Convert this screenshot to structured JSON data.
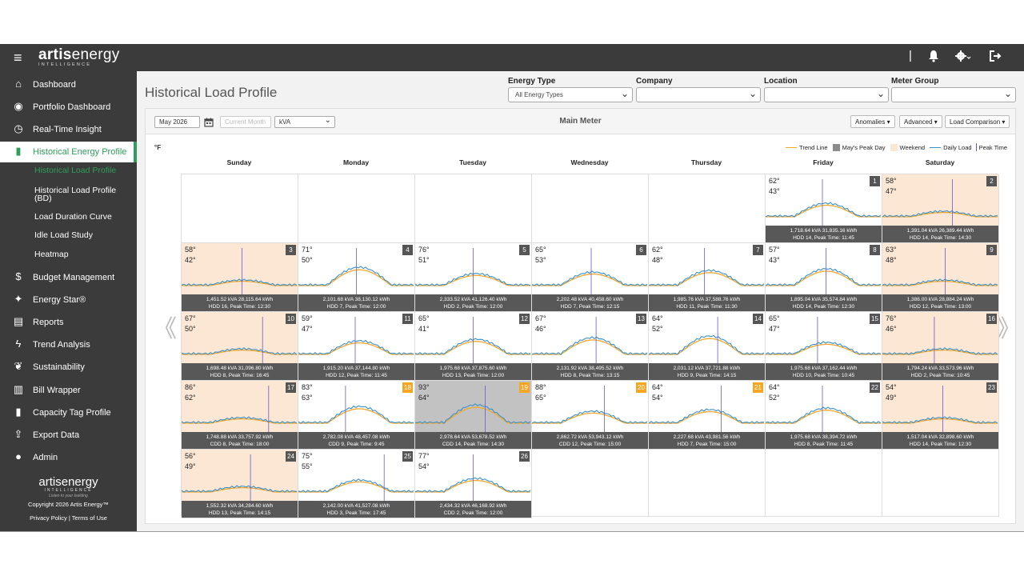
{
  "app": {
    "logo_main": "artisenergy",
    "logo_bold": "artis",
    "logo_rest": "energy",
    "logo_sub": "INTELLIGENCE",
    "hamburger_icon": "≡",
    "icons": {
      "bell": "bell-icon",
      "gear": "gear-icon",
      "logout": "logout-icon"
    }
  },
  "sidebar": {
    "items": [
      {
        "label": "Dashboard",
        "icon": "home-icon",
        "glyph": "⌂"
      },
      {
        "label": "Portfolio Dashboard",
        "icon": "speedometer-icon",
        "glyph": "◉"
      },
      {
        "label": "Real-Time Insight",
        "icon": "clock-icon",
        "glyph": "◷"
      },
      {
        "label": "Historical Energy Profile",
        "icon": "bar-chart-icon",
        "glyph": "▮"
      },
      {
        "label": "Budget Management",
        "icon": "dollar-icon",
        "glyph": "$"
      },
      {
        "label": "Energy Star®",
        "icon": "energy-star-icon",
        "glyph": "✦"
      },
      {
        "label": "Reports",
        "icon": "report-icon",
        "glyph": "▤"
      },
      {
        "label": "Trend Analysis",
        "icon": "lightning-icon",
        "glyph": "ϟ"
      },
      {
        "label": "Sustainability",
        "icon": "leaf-icon",
        "glyph": "❦"
      },
      {
        "label": "Bill Wrapper",
        "icon": "bill-icon",
        "glyph": "▥"
      },
      {
        "label": "Capacity Tag Profile",
        "icon": "capacity-icon",
        "glyph": "▮"
      },
      {
        "label": "Export Data",
        "icon": "export-icon",
        "glyph": "⇪"
      },
      {
        "label": "Admin",
        "icon": "user-icon",
        "glyph": "●"
      }
    ],
    "subitems": [
      "Historical Load Profile",
      "Historical Load Profile (BD)",
      "Load Duration Curve",
      "Idle Load Study",
      "Heatmap"
    ],
    "footer_logo": "artisenergy",
    "footer_logo_sub": "INTELLIGENCE",
    "footer_tagline": "Listen to your building",
    "copyright": "Copyright 2026 Artis Energy™",
    "privacy": "Privacy Policy",
    "terms": "Terms of Use"
  },
  "header": {
    "title": "Historical Load Profile",
    "filters": [
      {
        "label": "Energy Type",
        "value": "All Energy Types"
      },
      {
        "label": "Company",
        "value": ""
      },
      {
        "label": "Location",
        "value": ""
      },
      {
        "label": "Meter Group",
        "value": ""
      }
    ]
  },
  "toolbar": {
    "month": "May 2026",
    "current_month": "Current Month",
    "unit": "kVA",
    "meter": "Main Meter",
    "anomalies": "Anomalies ▾",
    "advanced": "Advanced ▾",
    "load_comparison": "Load Comparison ▾"
  },
  "calendar": {
    "temp_unit": "°F",
    "legend": {
      "trend_line": "Trend Line",
      "peak_day": "May's Peak Day",
      "weekend": "Weekend",
      "daily_load": "Daily Load",
      "peak_time": "Peak Time",
      "colors": {
        "trend": "#f0a830",
        "peak": "#8c8c8c",
        "weekend": "#fbe7d3",
        "daily": "#3a8fc8",
        "peak_time": "#6a5acd"
      }
    },
    "weekdays": [
      "Sunday",
      "Monday",
      "Tuesday",
      "Wednesday",
      "Thursday",
      "Friday",
      "Saturday"
    ],
    "days": [
      {
        "day": "1",
        "hi": "62°",
        "lo": "43°",
        "f1": "1,718.64 kVA 31,835.16 kWh",
        "f2": "HDD 14, Peak Time: 11:45"
      },
      {
        "day": "2",
        "hi": "58°",
        "lo": "47°",
        "f1": "1,391.04 kVA 26,389.44 kWh",
        "f2": "HDD 14, Peak Time: 14:30"
      },
      {
        "day": "3",
        "hi": "58°",
        "lo": "42°",
        "f1": "1,451.52 kVA 28,115.64 kWh",
        "f2": "HDD 16, Peak Time: 12:30"
      },
      {
        "day": "4",
        "hi": "71°",
        "lo": "50°",
        "f1": "2,101.68 kVA 38,130.12 kWh",
        "f2": "HDD 7, Peak Time: 12:00"
      },
      {
        "day": "5",
        "hi": "76°",
        "lo": "51°",
        "f1": "2,333.52 kVA 41,126.40 kWh",
        "f2": "HDD 2, Peak Time: 12:00"
      },
      {
        "day": "6",
        "hi": "65°",
        "lo": "53°",
        "f1": "2,202.48 kVA 40,458.60 kWh",
        "f2": "HDD 7, Peak Time: 12:15"
      },
      {
        "day": "7",
        "hi": "62°",
        "lo": "48°",
        "f1": "1,985.76 kVA 37,588.76 kWh",
        "f2": "HDD 11, Peak Time: 11:30"
      },
      {
        "day": "8",
        "hi": "57°",
        "lo": "43°",
        "f1": "1,895.04 kVA 35,574.84 kWh",
        "f2": "HDD 14, Peak Time: 12:30"
      },
      {
        "day": "9",
        "hi": "63°",
        "lo": "48°",
        "f1": "1,386.00 kVA 28,884.24 kWh",
        "f2": "HDD 12, Peak Time: 13:00"
      },
      {
        "day": "10",
        "hi": "67°",
        "lo": "50°",
        "f1": "1,698.48 kVA 31,096.80 kWh",
        "f2": "HDD 8, Peak Time: 16:45"
      },
      {
        "day": "11",
        "hi": "59°",
        "lo": "47°",
        "f1": "1,915.20 kVA 37,144.80 kWh",
        "f2": "HDD 12, Peak Time: 11:45"
      },
      {
        "day": "12",
        "hi": "65°",
        "lo": "41°",
        "f1": "1,975.68 kVA 37,875.60 kWh",
        "f2": "HDD 13, Peak Time: 12:00"
      },
      {
        "day": "13",
        "hi": "67°",
        "lo": "46°",
        "f1": "2,131.92 kVA 38,495.52 kWh",
        "f2": "HDD 8, Peak Time: 13:15"
      },
      {
        "day": "14",
        "hi": "64°",
        "lo": "52°",
        "f1": "2,031.12 kVA 37,721.88 kWh",
        "f2": "HDD 9, Peak Time: 14:15"
      },
      {
        "day": "15",
        "hi": "65°",
        "lo": "47°",
        "f1": "1,975.68 kVA 37,162.44 kWh",
        "f2": "HDD 10, Peak Time: 10:45"
      },
      {
        "day": "16",
        "hi": "76°",
        "lo": "46°",
        "f1": "1,794.24 kVA 33,573.96 kWh",
        "f2": "HDD 2, Peak Time: 10:45"
      },
      {
        "day": "17",
        "hi": "86°",
        "lo": "62°",
        "f1": "1,748.88 kVA 33,757.92 kWh",
        "f2": "CDD 8, Peak Time: 18:00"
      },
      {
        "day": "18",
        "hi": "83°",
        "lo": "63°",
        "f1": "2,782.08 kVA 48,457.08 kWh",
        "f2": "CDD 9, Peak Time: 9:45"
      },
      {
        "day": "19",
        "hi": "93°",
        "lo": "64°",
        "f1": "2,978.64 kVA 53,678.52 kWh",
        "f2": "CDD 14, Peak Time: 14:30"
      },
      {
        "day": "20",
        "hi": "88°",
        "lo": "65°",
        "f1": "2,862.72 kVA 53,943.12 kWh",
        "f2": "CDD 12, Peak Time: 15:00"
      },
      {
        "day": "21",
        "hi": "64°",
        "lo": "54°",
        "f1": "2,227.68 kVA 43,981.56 kWh",
        "f2": "HDD 7, Peak Time: 15:00"
      },
      {
        "day": "22",
        "hi": "64°",
        "lo": "52°",
        "f1": "1,975.68 kVA 38,394.72 kWh",
        "f2": "HDD 8, Peak Time: 11:45"
      },
      {
        "day": "23",
        "hi": "54°",
        "lo": "49°",
        "f1": "1,517.04 kVA 32,898.60 kWh",
        "f2": "HDD 14, Peak Time: 12:30"
      },
      {
        "day": "24",
        "hi": "56°",
        "lo": "49°",
        "f1": "1,552.32 kVA 34,284.60 kWh",
        "f2": "HDD 13, Peak Time: 14:15"
      },
      {
        "day": "25",
        "hi": "75°",
        "lo": "55°",
        "f1": "2,142.00 kVA 41,527.08 kWh",
        "f2": "HDD 3, Peak Time: 17:45"
      },
      {
        "day": "26",
        "hi": "77°",
        "lo": "54°",
        "f1": "2,434.32 kVA 46,168.92 kWh",
        "f2": "CDD 2, Peak Time: 12:00"
      }
    ]
  }
}
